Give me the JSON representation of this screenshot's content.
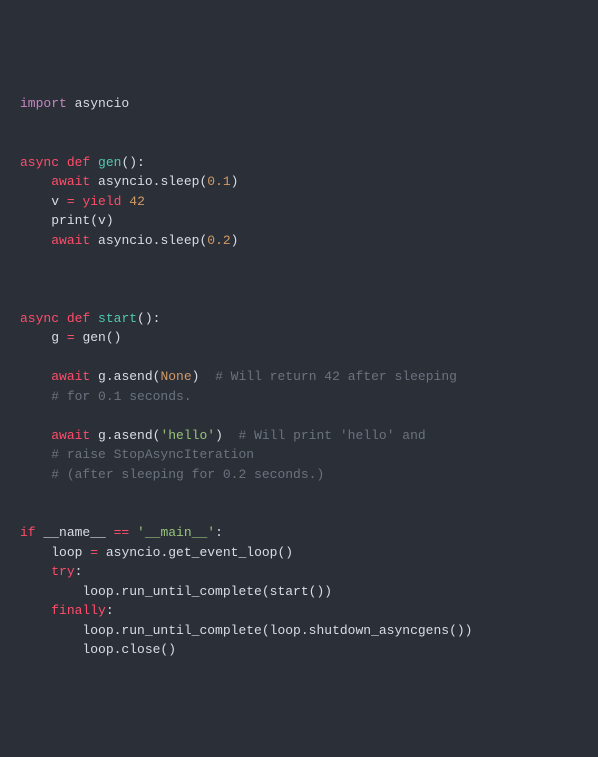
{
  "code": {
    "l1_import": "import",
    "l1_mod": " asyncio",
    "l4_async": "async",
    "l4_def": " def",
    "l4_fn": " gen",
    "l4_tail": "():",
    "l5_await": "await",
    "l5_rest_a": " asyncio.sleep(",
    "l5_num": "0.1",
    "l5_rest_b": ")",
    "l6_a": "v ",
    "l6_eq": "=",
    "l6_sp": " ",
    "l6_yield": "yield",
    "l6_sp2": " ",
    "l6_num": "42",
    "l7": "print(v)",
    "l8_await": "await",
    "l8_a": " asyncio.sleep(",
    "l8_num": "0.2",
    "l8_b": ")",
    "l12_async": "async",
    "l12_def": " def",
    "l12_fn": " start",
    "l12_tail": "():",
    "l13_a": "g ",
    "l13_eq": "=",
    "l13_b": " gen()",
    "l15_await": "await",
    "l15_a": " g.asend(",
    "l15_none": "None",
    "l15_b": ")  ",
    "l15_c": "# Will return 42 after sleeping",
    "l16": "# for 0.1 seconds.",
    "l18_await": "await",
    "l18_a": " g.asend(",
    "l18_str": "'hello'",
    "l18_b": ")  ",
    "l18_c": "# Will print 'hello' and",
    "l19": "# raise StopAsyncIteration",
    "l20": "# (after sleeping for 0.2 seconds.)",
    "l23_if": "if",
    "l23_a": " __name__ ",
    "l23_eq": "==",
    "l23_sp": " ",
    "l23_str": "'__main__'",
    "l23_b": ":",
    "l24_a": "loop ",
    "l24_eq": "=",
    "l24_b": " asyncio.get_event_loop()",
    "l25_try": "try",
    "l25_b": ":",
    "l26": "loop.run_until_complete(start())",
    "l27_fin": "finally",
    "l27_b": ":",
    "l28": "loop.run_until_complete(loop.shutdown_asyncgens())",
    "l29": "loop.close()"
  }
}
